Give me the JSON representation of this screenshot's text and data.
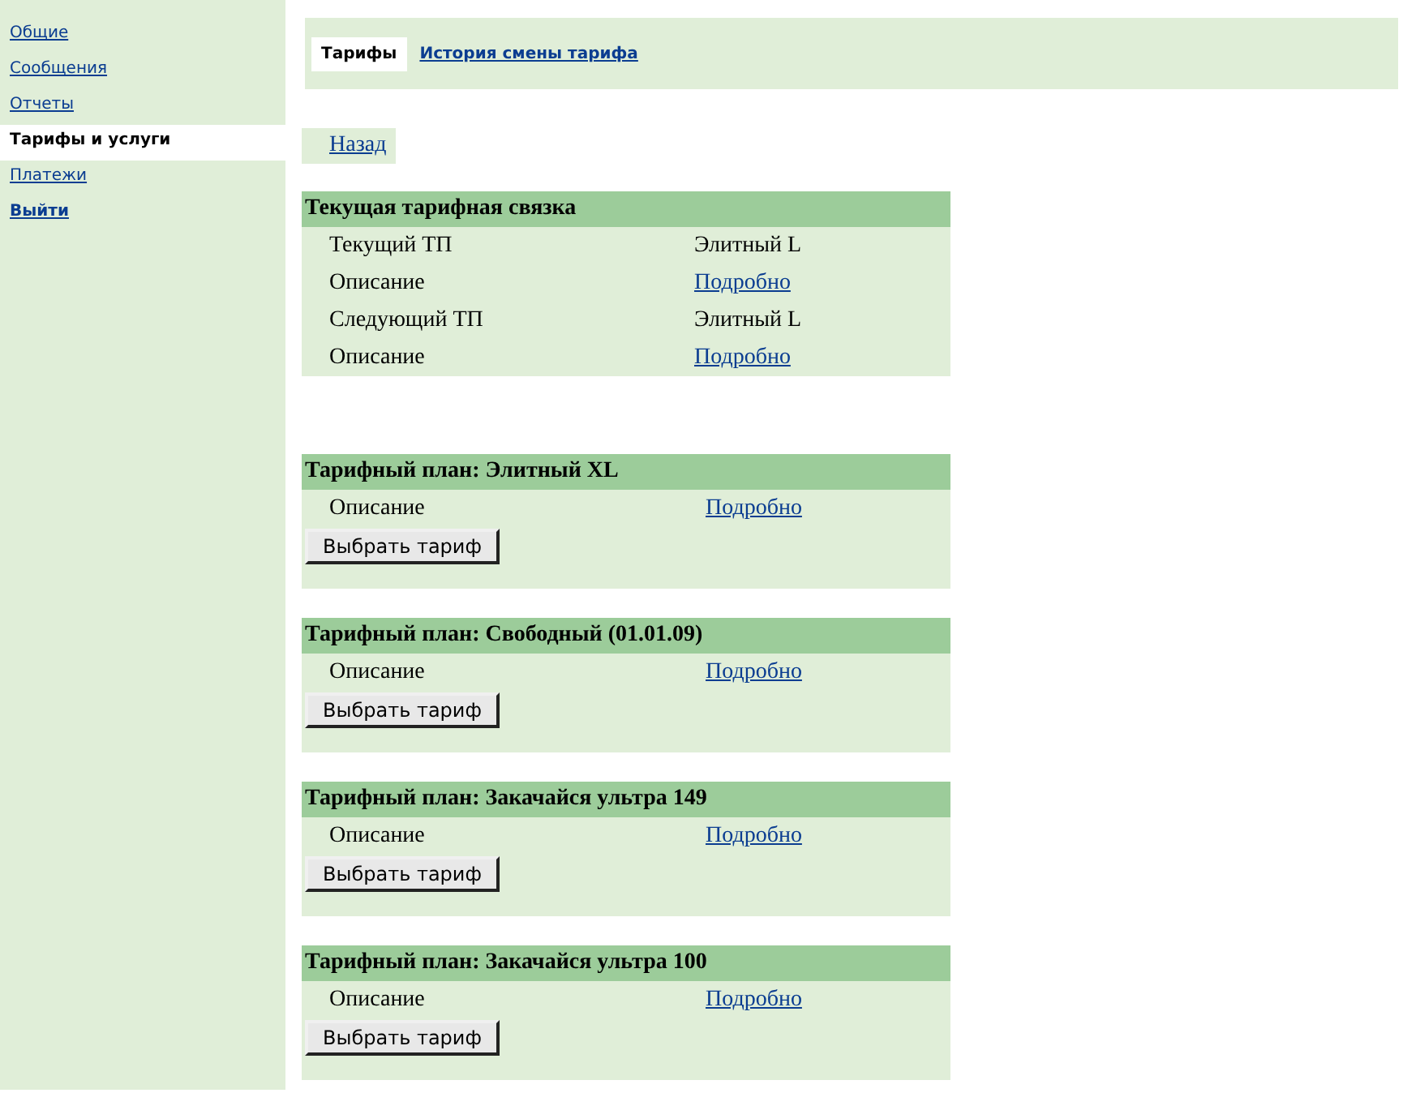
{
  "sidebar": {
    "items": [
      {
        "label": "Общие",
        "selected": false,
        "kind": "link"
      },
      {
        "label": "Сообщения",
        "selected": false,
        "kind": "link"
      },
      {
        "label": "Отчеты",
        "selected": false,
        "kind": "link"
      },
      {
        "label": "Тарифы и услуги",
        "selected": true,
        "kind": "link"
      },
      {
        "label": "Платежи",
        "selected": false,
        "kind": "link"
      },
      {
        "label": "Выйти",
        "selected": false,
        "kind": "logout"
      }
    ]
  },
  "tabs": [
    {
      "label": "Тарифы",
      "selected": true
    },
    {
      "label": "История смены тарифа",
      "selected": false
    }
  ],
  "back_link": "Назад",
  "current": {
    "title": "Текущая тарифная связка",
    "rows": [
      {
        "label": "Текущий ТП",
        "value": "Элитный L",
        "kind": "text"
      },
      {
        "label": "Описание",
        "value": "Подробно",
        "kind": "link"
      },
      {
        "label": "Следующий ТП",
        "value": "Элитный L",
        "kind": "text"
      },
      {
        "label": "Описание",
        "value": "Подробно",
        "kind": "link"
      }
    ]
  },
  "plans": [
    {
      "title": "Тарифный план: Элитный XL",
      "label": "Описание",
      "link": "Подробно",
      "button": "Выбрать тариф"
    },
    {
      "title": "Тарифный план: Свободный (01.01.09)",
      "label": "Описание",
      "link": "Подробно",
      "button": "Выбрать тариф"
    },
    {
      "title": "Тарифный план: Закачайся ультра 149",
      "label": "Описание",
      "link": "Подробно",
      "button": "Выбрать тариф"
    },
    {
      "title": "Тарифный план: Закачайся ультра 100",
      "label": "Описание",
      "link": "Подробно",
      "button": "Выбрать тариф"
    }
  ]
}
